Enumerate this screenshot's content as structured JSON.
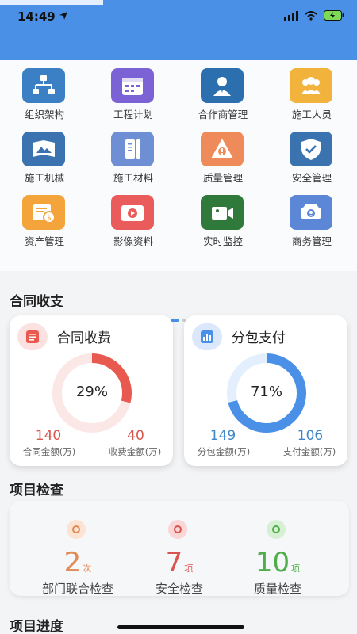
{
  "status_bar": {
    "time": "14:49"
  },
  "grid": {
    "items": [
      {
        "label": "组织架构",
        "icon": "org-chart-icon",
        "color": "#3b7fc4"
      },
      {
        "label": "工程计划",
        "icon": "calendar-icon",
        "color": "#7b63d6"
      },
      {
        "label": "合作商管理",
        "icon": "partner-icon",
        "color": "#2c6fae"
      },
      {
        "label": "施工人员",
        "icon": "workers-icon",
        "color": "#f2b33d"
      },
      {
        "label": "施工机械",
        "icon": "machinery-icon",
        "color": "#3a73b0"
      },
      {
        "label": "施工材料",
        "icon": "materials-icon",
        "color": "#6f8fd4"
      },
      {
        "label": "质量管理",
        "icon": "quality-icon",
        "color": "#ef8b5a"
      },
      {
        "label": "安全管理",
        "icon": "shield-icon",
        "color": "#3a73b0"
      },
      {
        "label": "资产管理",
        "icon": "asset-icon",
        "color": "#f3a43a"
      },
      {
        "label": "影像资料",
        "icon": "media-icon",
        "color": "#ea5b5b"
      },
      {
        "label": "实时监控",
        "icon": "monitor-icon",
        "color": "#2f7a3a"
      },
      {
        "label": "商务管理",
        "icon": "business-icon",
        "color": "#5b87d6"
      }
    ]
  },
  "contract_section": {
    "title": "合同收支"
  },
  "cards": {
    "income": {
      "title": "合同收费",
      "percent_label": "29%",
      "percent": 0.29,
      "color": "#e85a50",
      "track": "#fbe7e5",
      "left_value": "140",
      "left_label": "合同金额(万)",
      "right_value": "40",
      "right_label": "收费金额(万)",
      "value_color": "#d8584e"
    },
    "payment": {
      "title": "分包支付",
      "percent_label": "71%",
      "percent": 0.71,
      "color": "#4a90e6",
      "track": "#e3effc",
      "left_value": "149",
      "left_label": "分包金额(万)",
      "right_value": "106",
      "right_label": "支付金额(万)",
      "value_color": "#3f86c9"
    }
  },
  "inspection_section": {
    "title": "项目检查",
    "items": [
      {
        "value": "2",
        "unit": "次",
        "label": "部门联合检查",
        "color": "#e08a55",
        "dot_bg": "#fde3d4"
      },
      {
        "value": "7",
        "unit": "项",
        "label": "安全检查",
        "color": "#d9534f",
        "dot_bg": "#fad6d6"
      },
      {
        "value": "10",
        "unit": "项",
        "label": "质量检查",
        "color": "#4fae4a",
        "dot_bg": "#d7f0d3"
      }
    ]
  },
  "progress_section": {
    "title": "项目进度"
  }
}
